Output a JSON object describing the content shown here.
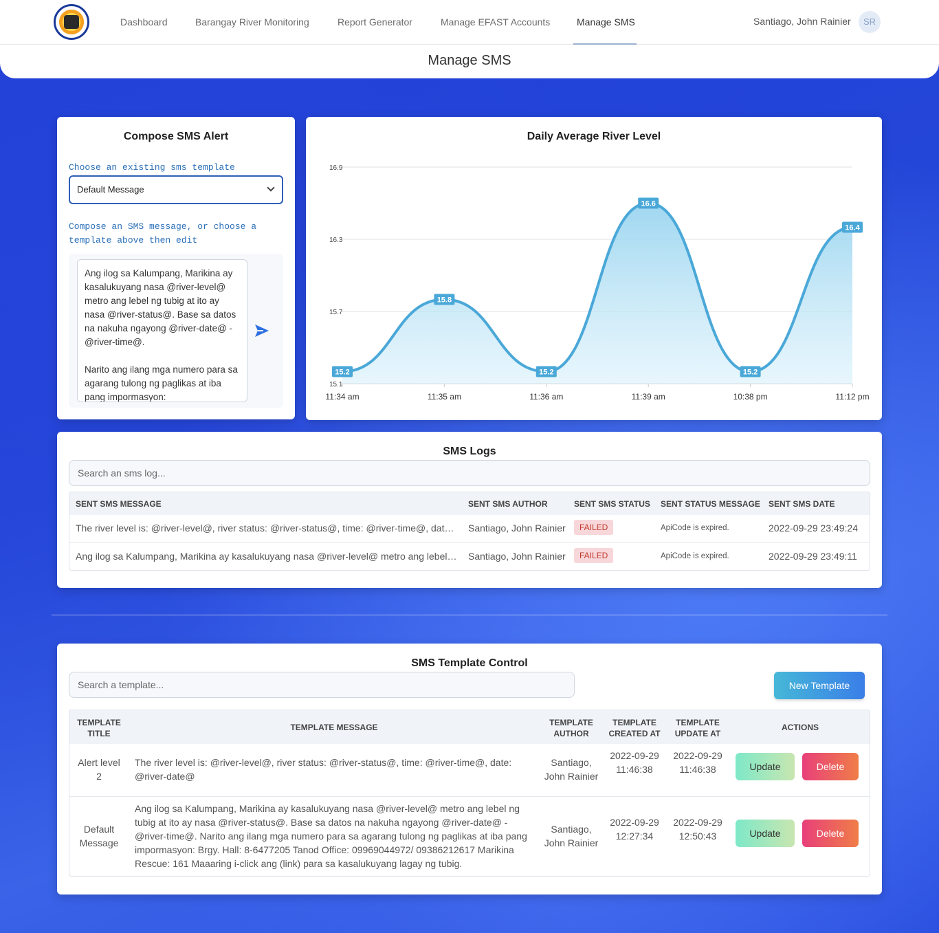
{
  "nav": {
    "items": [
      "Dashboard",
      "Barangay River Monitoring",
      "Report Generator",
      "Manage EFAST Accounts",
      "Manage SMS"
    ],
    "active": "Manage SMS",
    "user_name": "Santiago, John Rainier",
    "avatar_initials": "SR"
  },
  "page": {
    "title": "Manage SMS"
  },
  "compose": {
    "title": "Compose SMS Alert",
    "template_label": "Choose an existing sms template",
    "selected_template": "Default Message",
    "message_label": "Compose an SMS message, or choose a template above then edit",
    "message_text": "Ang ilog sa Kalumpang, Marikina ay kasalukuyang nasa @river-level@ metro ang lebel ng tubig at ito ay nasa @river-status@. Base sa datos na nakuha ngayong @river-date@ - @river-time@.\n\nNarito ang ilang mga numero para sa agarang tulong ng paglikas at iba pang impormasyon:"
  },
  "chart_data": {
    "type": "area",
    "title": "Daily Average River Level",
    "categories": [
      "11:34 am",
      "11:35 am",
      "11:36 am",
      "11:39 am",
      "10:38 pm",
      "11:12 pm"
    ],
    "values": [
      15.2,
      15.8,
      15.2,
      16.6,
      15.2,
      16.4
    ],
    "y_ticks": [
      "16.9",
      "16.3",
      "15.7",
      "15.1"
    ],
    "ylim": [
      15.1,
      16.9
    ],
    "grid": true,
    "color": "#4aa8d8"
  },
  "logs": {
    "title": "SMS Logs",
    "search_placeholder": "Search an sms log...",
    "headers": [
      "Sent SMS Message",
      "Sent SMS Author",
      "Sent SMS Status",
      "Sent Status Message",
      "Sent SMS Date"
    ],
    "rows": [
      {
        "message": "The river level is: @river-level@, river status: @river-status@, time: @river-time@, date: @river-date@",
        "author": "Santiago, John Rainier",
        "status": "FAILED",
        "status_message": "ApiCode is expired.",
        "date": "2022-09-29 23:49:24"
      },
      {
        "message": "Ang ilog sa Kalumpang, Marikina ay kasalukuyang nasa @river-level@ metro ang lebel ng tubig",
        "author": "Santiago, John Rainier",
        "status": "FAILED",
        "status_message": "ApiCode is expired.",
        "date": "2022-09-29 23:49:11"
      }
    ]
  },
  "templates": {
    "title": "SMS Template Control",
    "search_placeholder": "Search a template...",
    "new_button": "New Template",
    "headers": [
      "Template Title",
      "Template Message",
      "Template Author",
      "Template Created At",
      "Template Update At",
      "Actions"
    ],
    "update_label": "Update",
    "delete_label": "Delete",
    "rows": [
      {
        "title": "Alert level 2",
        "message": "The river level is: @river-level@, river status: @river-status@, time: @river-time@, date: @river-date@",
        "author": "Santiago, John Rainier",
        "created": "2022-09-29 11:46:38",
        "updated": "2022-09-29 11:46:38"
      },
      {
        "title": "Default Message",
        "message": "Ang ilog sa Kalumpang, Marikina ay kasalukuyang nasa @river-level@ metro ang lebel ng tubig at ito ay nasa @river-status@. Base sa datos na nakuha ngayong @river-date@ - @river-time@. Narito ang ilang mga numero para sa agarang tulong ng paglikas at iba pang impormasyon: Brgy. Hall: 8-6477205 Tanod Office: 09969044972/ 09386212617 Marikina Rescue: 161 Maaaring i-click ang (link) para sa kasalukuyang lagay ng tubig.",
        "author": "Santiago, John Rainier",
        "created": "2022-09-29 12:27:34",
        "updated": "2022-09-29 12:50:43"
      }
    ]
  }
}
